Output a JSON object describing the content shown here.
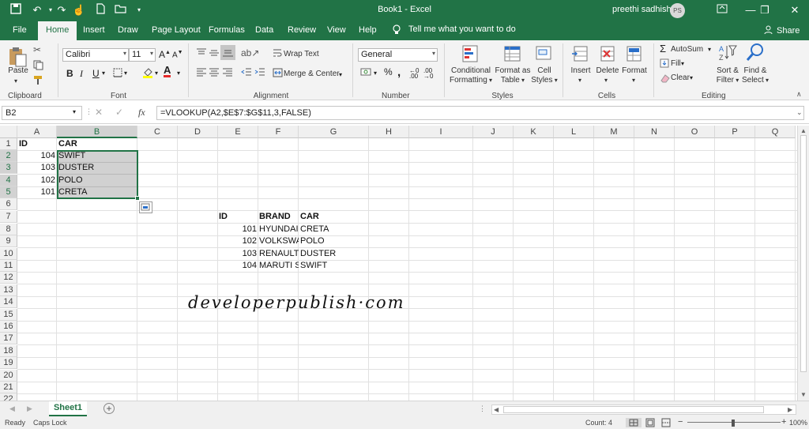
{
  "window": {
    "title": "Book1  -  Excel",
    "user_name": "preethi sadhish",
    "user_initials": "PS",
    "controls": {
      "minimize": "—",
      "restore": "❐",
      "close": "✕"
    }
  },
  "tabs": [
    "File",
    "Home",
    "Insert",
    "Draw",
    "Page Layout",
    "Formulas",
    "Data",
    "Review",
    "View",
    "Help"
  ],
  "tell_me": "Tell me what you want to do",
  "share_label": "Share",
  "ribbon": {
    "clipboard": {
      "group": "Clipboard",
      "paste": "Paste"
    },
    "font": {
      "group": "Font",
      "name": "Calibri",
      "size": "11"
    },
    "alignment": {
      "group": "Alignment",
      "wrap_text": "Wrap Text",
      "merge_center": "Merge & Center"
    },
    "number": {
      "group": "Number",
      "format": "General"
    },
    "styles": {
      "group": "Styles",
      "conditional_1": "Conditional",
      "conditional_2": "Formatting",
      "format_as_1": "Format as",
      "format_as_2": "Table",
      "cell_styles_1": "Cell",
      "cell_styles_2": "Styles"
    },
    "cells": {
      "group": "Cells",
      "insert": "Insert",
      "delete": "Delete",
      "format": "Format"
    },
    "editing": {
      "group": "Editing",
      "autosum": "AutoSum",
      "fill": "Fill",
      "clear": "Clear",
      "sort_1": "Sort &",
      "sort_2": "Filter",
      "find_1": "Find &",
      "find_2": "Select"
    }
  },
  "formula_bar": {
    "name_box": "B2",
    "formula": "=VLOOKUP(A2,$E$7:$G$11,3,FALSE)"
  },
  "grid": {
    "columns": [
      "A",
      "B",
      "C",
      "D",
      "E",
      "F",
      "G",
      "H",
      "I",
      "J",
      "K",
      "L",
      "M",
      "N",
      "O",
      "P",
      "Q"
    ],
    "rows": [
      "1",
      "2",
      "3",
      "4",
      "5",
      "6",
      "7",
      "8",
      "9",
      "10",
      "11",
      "12",
      "13",
      "14",
      "15",
      "16",
      "17",
      "18",
      "19",
      "20",
      "21",
      "22"
    ],
    "table1": {
      "header": [
        "ID",
        "CAR"
      ],
      "rows": [
        [
          "104",
          "SWIFT"
        ],
        [
          "103",
          "DUSTER"
        ],
        [
          "102",
          "POLO"
        ],
        [
          "101",
          "CRETA"
        ]
      ]
    },
    "table2": {
      "header": [
        "ID",
        "BRAND",
        "CAR"
      ],
      "rows": [
        [
          "101",
          "HYUNDAI",
          "CRETA"
        ],
        [
          "102",
          "VOLKSWA",
          "POLO"
        ],
        [
          "103",
          "RENAULT",
          "DUSTER"
        ],
        [
          "104",
          "MARUTI S",
          "SWIFT"
        ]
      ]
    }
  },
  "watermark": "developerpublish·com",
  "sheet_tabs": [
    "Sheet1"
  ],
  "status": {
    "ready": "Ready",
    "caps": "Caps Lock",
    "count": "Count: 4",
    "zoom": "100%"
  },
  "colors": {
    "accent": "#217346"
  }
}
